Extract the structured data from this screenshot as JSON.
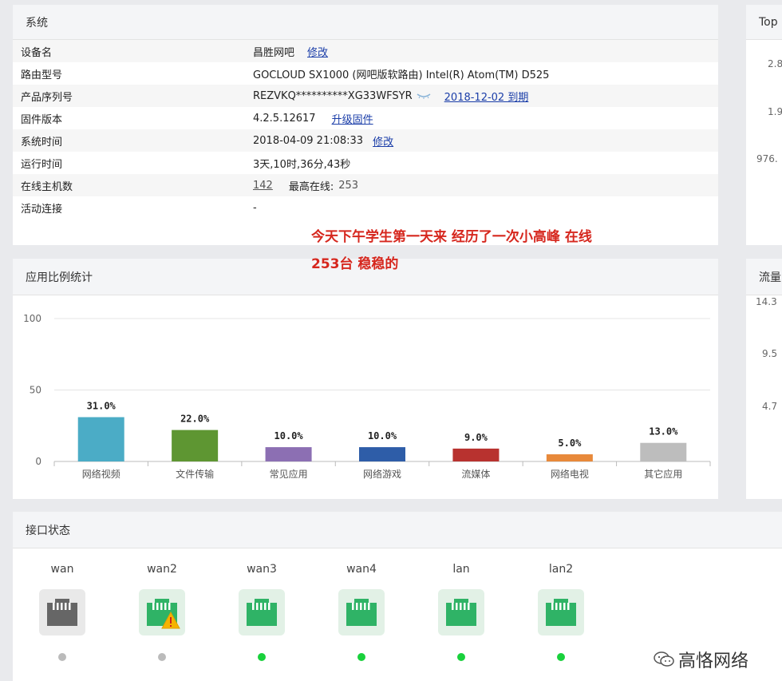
{
  "system": {
    "title": "系统",
    "rows": [
      {
        "label": "设备名",
        "value": "昌胜网吧",
        "link": "修改"
      },
      {
        "label": "路由型号",
        "value": "GOCLOUD SX1000 (网吧版软路由) Intel(R) Atom(TM) D525"
      },
      {
        "label": "产品序列号",
        "value": "REZVKQ**********XG33WFSYR",
        "link": "2018-12-02 到期"
      },
      {
        "label": "固件版本",
        "value": "4.2.5.12617",
        "link": "升级固件"
      },
      {
        "label": "系统时间",
        "value": "2018-04-09 21:08:33",
        "link": "修改"
      },
      {
        "label": "运行时间",
        "value": "3天,10时,36分,43秒"
      },
      {
        "label": "在线主机数",
        "value": "142",
        "extra_label": "最高在线:",
        "extra_value": "253"
      },
      {
        "label": "活动连接",
        "value": "-"
      }
    ]
  },
  "annotation": {
    "line1": "今天下午学生第一天来 经历了一次小高峰 在线",
    "line2": "253台  稳稳的"
  },
  "top_panel": {
    "title": "Top",
    "y_values": [
      "2.8",
      "1.9",
      "976."
    ]
  },
  "app_stats": {
    "title": "应用比例统计"
  },
  "chart_data": {
    "type": "bar",
    "categories": [
      "网络视频",
      "文件传输",
      "常见应用",
      "网络游戏",
      "流媒体",
      "网络电视",
      "其它应用"
    ],
    "values": [
      31.0,
      22.0,
      10.0,
      10.0,
      9.0,
      5.0,
      13.0
    ],
    "labels": [
      "31.0%",
      "22.0%",
      "10.0%",
      "10.0%",
      "9.0%",
      "5.0%",
      "13.0%"
    ],
    "colors": [
      "#4bacc6",
      "#5e9632",
      "#8c6fb3",
      "#2e5da8",
      "#b8322f",
      "#e8893a",
      "#bdbdbd"
    ],
    "ylim": [
      0,
      100
    ],
    "yticks": [
      "100",
      "50",
      "0"
    ],
    "grid": true
  },
  "flow_panel": {
    "title": "流量",
    "y_values": [
      "14.3",
      "9.5",
      "4.7"
    ]
  },
  "interfaces": {
    "title": "接口状态",
    "ports": [
      {
        "name": "wan",
        "state": "disconnected",
        "warning": false,
        "color": "#666666",
        "bg": "#e9e9e9",
        "dot": "#bbbbbb"
      },
      {
        "name": "wan2",
        "state": "connected",
        "warning": true,
        "color": "#2fb366",
        "bg": "#e2f1e6",
        "dot": "#bbbbbb"
      },
      {
        "name": "wan3",
        "state": "connected",
        "warning": false,
        "color": "#2fb366",
        "bg": "#e2f1e6",
        "dot": "#19d13c"
      },
      {
        "name": "wan4",
        "state": "connected",
        "warning": false,
        "color": "#2fb366",
        "bg": "#e2f1e6",
        "dot": "#19d13c"
      },
      {
        "name": "lan",
        "state": "connected",
        "warning": false,
        "color": "#2fb366",
        "bg": "#e2f1e6",
        "dot": "#19d13c"
      },
      {
        "name": "lan2",
        "state": "connected",
        "warning": false,
        "color": "#2fb366",
        "bg": "#e2f1e6",
        "dot": "#19d13c"
      }
    ]
  },
  "watermark": {
    "text": "高恪网络",
    "icon": "wechat-icon"
  }
}
